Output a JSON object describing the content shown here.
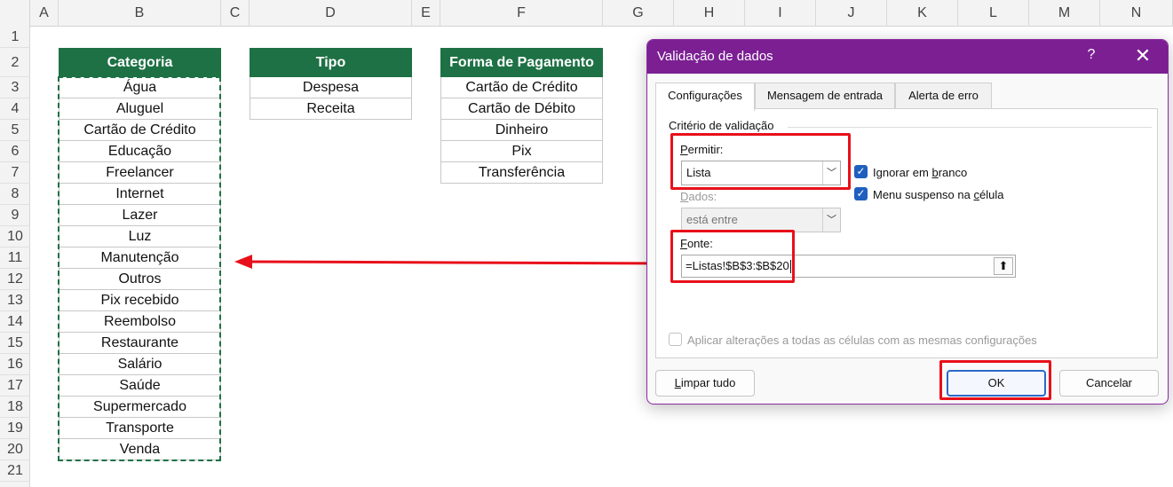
{
  "spreadsheet": {
    "columns": [
      "A",
      "B",
      "C",
      "D",
      "E",
      "F",
      "G",
      "H",
      "I",
      "J",
      "K",
      "L",
      "M",
      "N"
    ],
    "rows": [
      "1",
      "2",
      "3",
      "4",
      "5",
      "6",
      "7",
      "8",
      "9",
      "10",
      "11",
      "12",
      "13",
      "14",
      "15",
      "16",
      "17",
      "18",
      "19",
      "20",
      "21"
    ]
  },
  "tables": {
    "categoria": {
      "header": "Categoria",
      "items": [
        "Água",
        "Aluguel",
        "Cartão de Crédito",
        "Educação",
        "Freelancer",
        "Internet",
        "Lazer",
        "Luz",
        "Manutenção",
        "Outros",
        "Pix recebido",
        "Reembolso",
        "Restaurante",
        "Salário",
        "Saúde",
        "Supermercado",
        "Transporte",
        "Venda"
      ]
    },
    "tipo": {
      "header": "Tipo",
      "items": [
        "Despesa",
        "Receita"
      ]
    },
    "forma_pagamento": {
      "header": "Forma de Pagamento",
      "items": [
        "Cartão de Crédito",
        "Cartão de Débito",
        "Dinheiro",
        "Pix",
        "Transferência"
      ]
    }
  },
  "dialog": {
    "title": "Validação de dados",
    "help_label": "?",
    "close_label": "✕",
    "tabs": [
      {
        "label": "Configurações",
        "active": true
      },
      {
        "label": "Mensagem de entrada",
        "active": false
      },
      {
        "label": "Alerta de erro",
        "active": false
      }
    ],
    "group_title": "Critério de validação",
    "permitir": {
      "label_first": "P",
      "label_rest": "ermitir:",
      "value": "Lista"
    },
    "dados": {
      "label_first": "D",
      "label_rest": "ados:",
      "value": "está entre"
    },
    "ignorar_em_branco": {
      "label_pre": "Ignorar em ",
      "label_u": "b",
      "label_post": "ranco",
      "checked": true
    },
    "menu_suspenso": {
      "label_pre": "Menu suspenso na ",
      "label_u": "c",
      "label_post": "élula",
      "checked": true
    },
    "fonte": {
      "label_first": "F",
      "label_rest": "onte:",
      "value": "=Listas!$B$3:$B$20"
    },
    "aplicar": {
      "label": "Aplicar alterações a todas as células com as mesmas configurações",
      "checked": false
    },
    "buttons": {
      "limpar_first": "L",
      "limpar_rest": "impar tudo",
      "ok": "OK",
      "cancelar": "Cancelar"
    }
  },
  "colors": {
    "header_green": "#1e7145",
    "dialog_purple": "#7b1f93",
    "highlight_red": "#e8101a",
    "checkbox_blue": "#1f5fbf"
  }
}
